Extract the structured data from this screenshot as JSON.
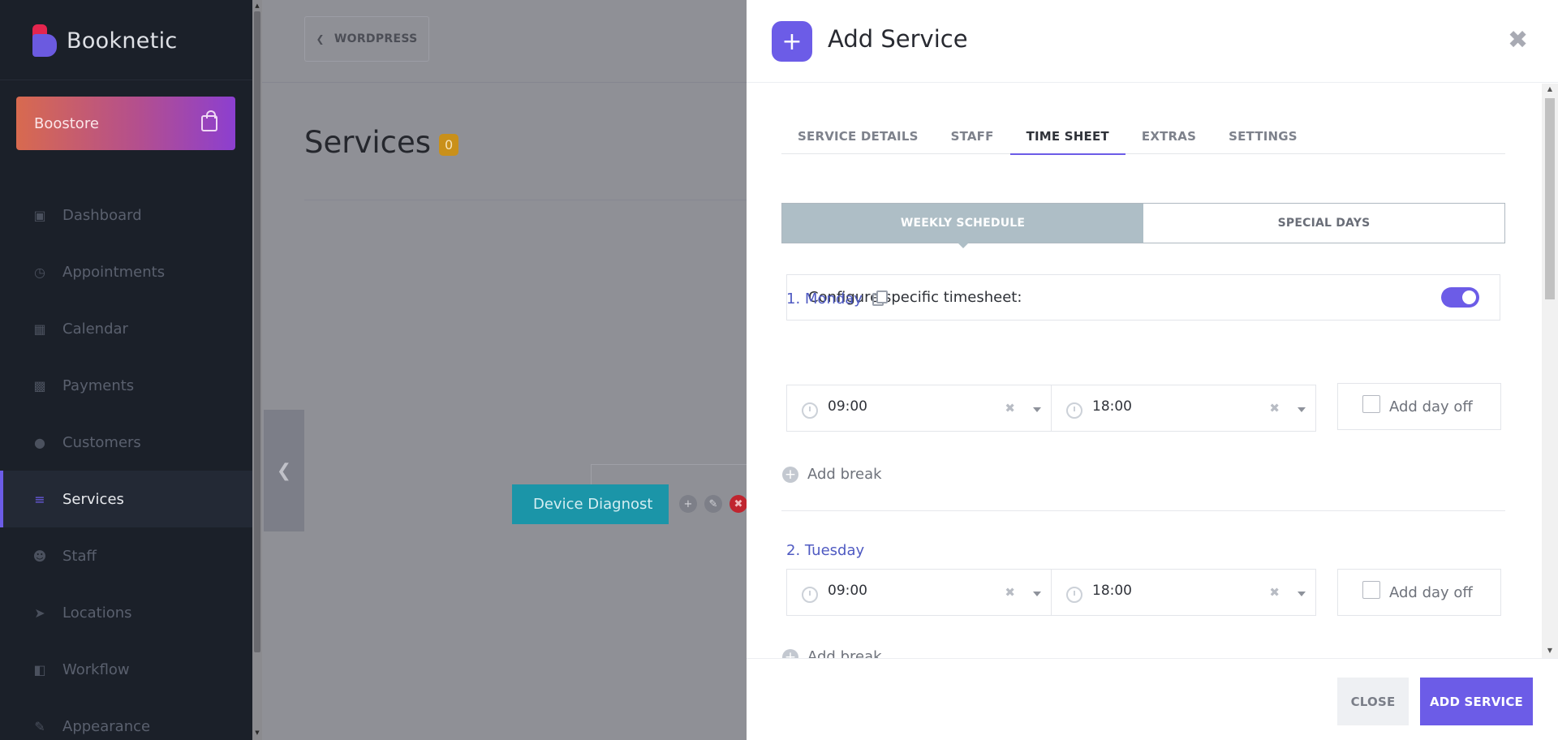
{
  "app": {
    "name": "Booknetic"
  },
  "boostore": {
    "label": "Boostore"
  },
  "sidebar": {
    "items": [
      {
        "label": "Dashboard",
        "icon": "cube-icon",
        "active": false
      },
      {
        "label": "Appointments",
        "icon": "clock-icon",
        "active": false
      },
      {
        "label": "Calendar",
        "icon": "calendar-icon",
        "active": false
      },
      {
        "label": "Payments",
        "icon": "wallet-icon",
        "active": false
      },
      {
        "label": "Customers",
        "icon": "users-icon",
        "active": false
      },
      {
        "label": "Services",
        "icon": "list-icon",
        "active": true
      },
      {
        "label": "Staff",
        "icon": "user-icon",
        "active": false
      },
      {
        "label": "Locations",
        "icon": "location-arrow-icon",
        "active": false
      },
      {
        "label": "Workflow",
        "icon": "workflow-icon",
        "active": false
      },
      {
        "label": "Appearance",
        "icon": "brush-icon",
        "active": false
      }
    ]
  },
  "main": {
    "back_button": "WORDPRESS",
    "page_title": "Services",
    "count": "0",
    "service_node": "Device Diagnost"
  },
  "modal": {
    "title": "Add Service",
    "tabs": [
      {
        "label": "SERVICE DETAILS",
        "active": false
      },
      {
        "label": "STAFF",
        "active": false
      },
      {
        "label": "TIME SHEET",
        "active": true
      },
      {
        "label": "EXTRAS",
        "active": false
      },
      {
        "label": "SETTINGS",
        "active": false
      }
    ],
    "segments": {
      "weekly": "WEEKLY SCHEDULE",
      "special": "SPECIAL DAYS"
    },
    "configure_label": "Configure specific timesheet:",
    "configure_enabled": true,
    "days": [
      {
        "label": "1. Monday",
        "start": "09:00",
        "end": "18:00",
        "day_off_label": "Add day off",
        "add_break": "Add break"
      },
      {
        "label": "2. Tuesday",
        "start": "09:00",
        "end": "18:00",
        "day_off_label": "Add day off",
        "add_break": "Add break"
      }
    ],
    "footer": {
      "close": "CLOSE",
      "add": "ADD SERVICE"
    }
  },
  "colors": {
    "accent": "#6c5ce7",
    "sidebar_bg": "#1b2029",
    "service_node": "#1b95a8",
    "badge": "#c9901a"
  }
}
